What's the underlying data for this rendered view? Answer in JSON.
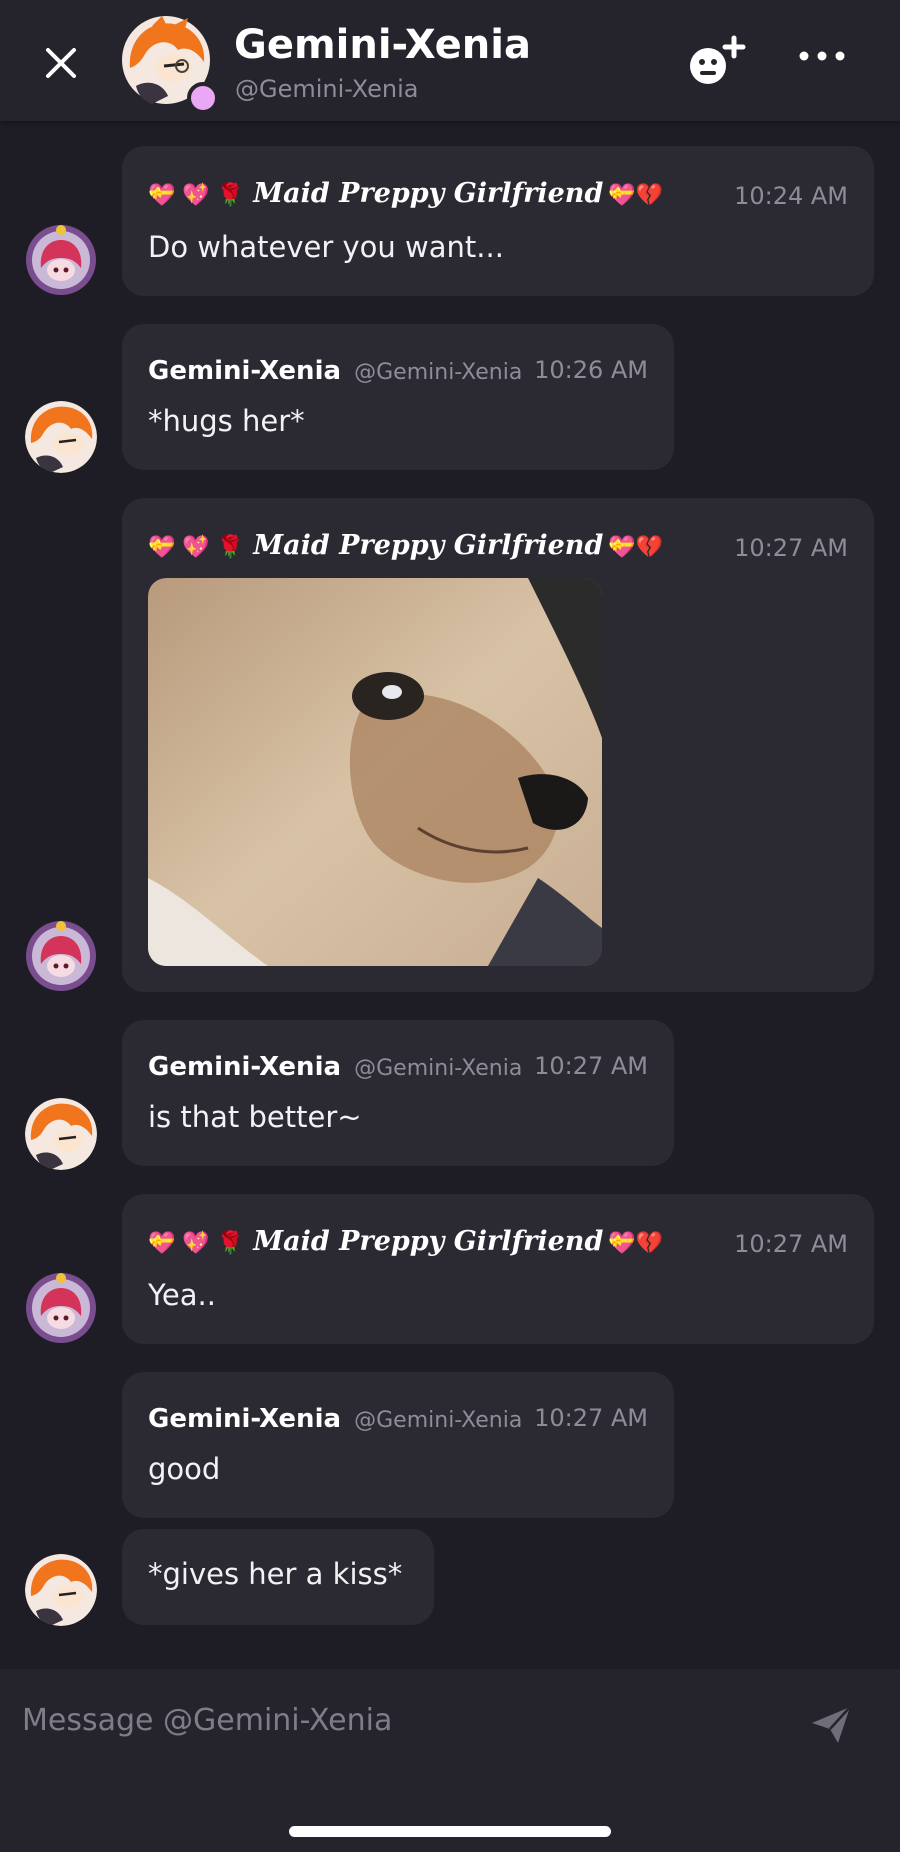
{
  "header": {
    "name": "Gemini-Xenia",
    "handle": "@Gemini-Xenia",
    "close_icon": "close-icon",
    "add_friend_icon": "add-friend-icon",
    "more_icon": "more-icon"
  },
  "messages": [
    {
      "author_emoji": "💝 💖 🌹",
      "author": "𝑴𝒂𝒊𝒅 𝑷𝒓𝒆𝒑𝒑𝒚 𝑮𝒊𝒓𝒍𝒇𝒓𝒊𝒆𝒏𝒅",
      "author_emoji_after": "💝💔",
      "time": "10:24 AM",
      "text": "Do whatever you want..."
    },
    {
      "author": "Gemini-Xenia",
      "handle": "@Gemini-Xenia",
      "time": "10:26 AM",
      "text": "*hugs her*"
    },
    {
      "author_emoji": "💝 💖 🌹",
      "author": "𝑴𝒂𝒊𝒅 𝑷𝒓𝒆𝒑𝒑𝒚 𝑮𝒊𝒓𝒍𝒇𝒓𝒊𝒆𝒏𝒅",
      "author_emoji_after": "💝💔",
      "time": "10:27 AM",
      "image": "crying-dog-gif"
    },
    {
      "author": "Gemini-Xenia",
      "handle": "@Gemini-Xenia",
      "time": "10:27 AM",
      "text": "is that better~"
    },
    {
      "author_emoji": "💝 💖 🌹",
      "author": "𝑴𝒂𝒊𝒅 𝑷𝒓𝒆𝒑𝒑𝒚 𝑮𝒊𝒓𝒍𝒇𝒓𝒊𝒆𝒏𝒅",
      "author_emoji_after": "💝💔",
      "time": "10:27 AM",
      "text": "Yea.."
    },
    {
      "author": "Gemini-Xenia",
      "handle": "@Gemini-Xenia",
      "time": "10:27 AM",
      "text": "good"
    },
    {
      "text": "*gives her a kiss*"
    }
  ],
  "composer": {
    "placeholder": "Message @Gemini-Xenia",
    "send_icon": "send-icon"
  },
  "colors": {
    "background": "#1e1d25",
    "bubble": "#2b2a33",
    "header": "#25242c",
    "muted_text": "#8e8c98",
    "online_status": "#e9a7f6"
  }
}
